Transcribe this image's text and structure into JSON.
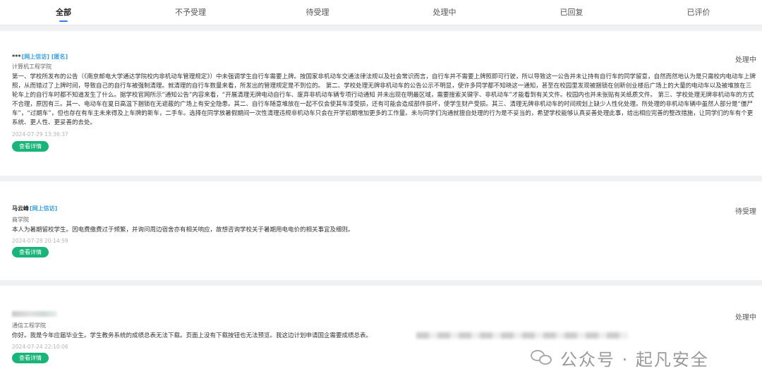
{
  "tabs": [
    {
      "label": "全部",
      "active": true
    },
    {
      "label": "不予受理"
    },
    {
      "label": "待受理"
    },
    {
      "label": "处理中"
    },
    {
      "label": "已回复"
    },
    {
      "label": "已评价"
    }
  ],
  "detail_button_label": "查看详情",
  "items": [
    {
      "name": "***",
      "tags": [
        "[网上信访]",
        "[匿名]"
      ],
      "college": "计算机工程学院",
      "status": "处理中",
      "content": "第一、学校所发布的公告（《南京邮电大学通达学院校内非机动车管理规定》）中未强调学生自行车需要上牌。按国家非机动车交通法律法规以及社会常识而言，自行车并不需要上牌照即可行驶，所以导致这一公告并未让持有自行车的同学留意，自然而然地认为是只需校内电动车上牌照，从而错过了上牌时间，导致自己的自行车被强制清理。就清理的自行车数量来看，所发出的管理规定是不到位的。 第二、学校处理无牌非机动车的公告公示不明显，使许多同学都不知晓这一通知，甚至在校园里发现被捆锁在创新创业楼后广场上的大量的电动车以及被堆放在三轮车上的自行车时都不知道发生了什么。据学校官网所示“通知公告”内容来看，“开展清理无牌电动自行车、废弃非机动车辆专项行动通知 并未出现在明最区域，需要搜索关键字、非机动车”才能看到有关文件。校园内也并未张贴有关纸质文件。 第三、学校处理无牌非机动车的方式不合理，原因有三。其一、电动车在夏日高温下捆锁在无遮蔽的广场上有安全隐患。其二、自行车随意堆放在一起不仅会使其车漆受损，还有可能会造成部件损坏，使学生财产受损。其三、清理无牌非机动车的时间规划上缺少人性化处理。所处理的非机动车辆中虽然人部分是“僵尸车”，“过期车”，但也存在有车主未来得及上车牌的新车，二手车。选择在同学放暑假期间一次性清理违规非机动车只会在开学初期增加更多的工作量。未与同学们沟通就擅自处理的行为是不妥当的，希望学校能够认真妥善处理此事，给出相应完善的整改措施，让同学们的车有个更系统、更人性、更妥善的去处。",
      "time": "2024-07-29 13:36:37"
    },
    {
      "name": "马云峰",
      "tags": [
        "[网上信访]"
      ],
      "college": "商学院",
      "status": "待受理",
      "content": "本人为暑期留校学生。因电费缴费过于频繁，并询问周边宿舍亦有相关响应，故想咨询学校关于暑期用电电价的相关事宜及细则。",
      "time": "2024-07-28 20:14:59"
    },
    {
      "name": "",
      "tags": [],
      "college": "通信工程学院",
      "status": "处理中",
      "content": "你好。我是今年应届毕业生。学生教务系统的成绩总表无法下载。页面上没有下载按钮也无法预览。我这边计划申请国企需要成绩总表。",
      "time": "2024-07-24 22:10:06"
    }
  ],
  "watermark": {
    "text": "公众号 · 起凡安全",
    "icon": "wechat-icon"
  }
}
